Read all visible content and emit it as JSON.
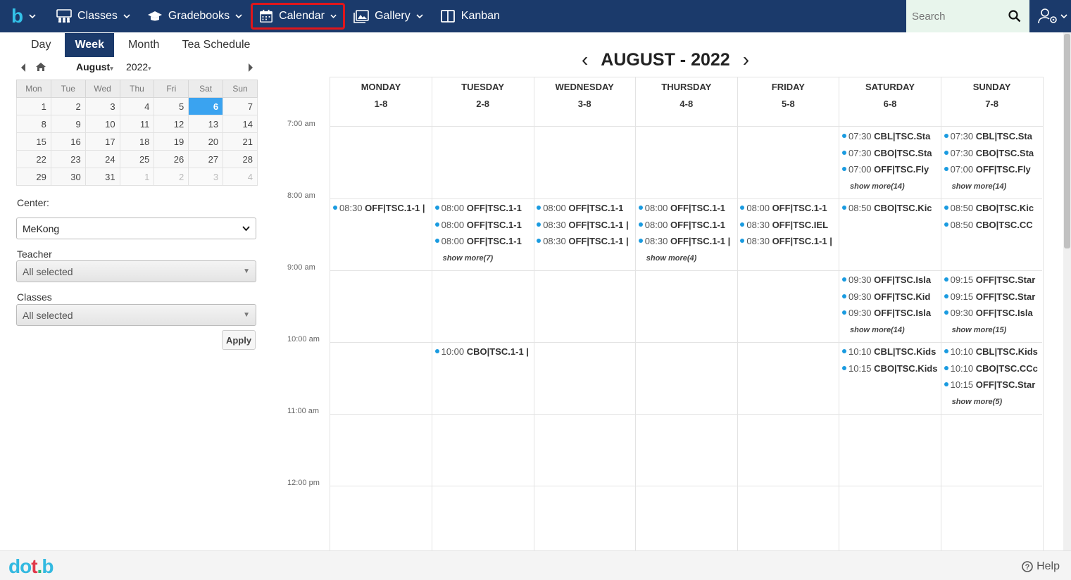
{
  "nav": {
    "brand_letter": "b",
    "items": [
      {
        "label": "Classes",
        "icon": "classes-icon"
      },
      {
        "label": "Gradebooks",
        "icon": "graduation-cap-icon"
      },
      {
        "label": "Calendar",
        "icon": "calendar-icon",
        "highlighted": true
      },
      {
        "label": "Gallery",
        "icon": "gallery-icon"
      },
      {
        "label": "Kanban",
        "icon": "kanban-icon"
      }
    ],
    "search_placeholder": "Search"
  },
  "view_tabs": [
    "Day",
    "Week",
    "Month",
    "Tea Schedule"
  ],
  "active_view": "Week",
  "mini_calendar": {
    "month": "August",
    "year": "2022",
    "weekdays": [
      "Mon",
      "Tue",
      "Wed",
      "Thu",
      "Fri",
      "Sat",
      "Sun"
    ],
    "weeks": [
      [
        "1",
        "2",
        "3",
        "4",
        "5",
        "6",
        "7"
      ],
      [
        "8",
        "9",
        "10",
        "11",
        "12",
        "13",
        "14"
      ],
      [
        "15",
        "16",
        "17",
        "18",
        "19",
        "20",
        "21"
      ],
      [
        "22",
        "23",
        "24",
        "25",
        "26",
        "27",
        "28"
      ],
      [
        "29",
        "30",
        "31",
        "1",
        "2",
        "3",
        "4"
      ]
    ],
    "selected": "6"
  },
  "filters": {
    "center_label": "Center:",
    "center_value": "MeKong",
    "teacher_label": "Teacher",
    "teacher_value": "All selected",
    "classes_label": "Classes",
    "classes_value": "All selected",
    "apply_label": "Apply"
  },
  "calendar": {
    "title": "AUGUST - 2022",
    "prev": "‹",
    "next": "›",
    "days": [
      {
        "name": "MONDAY",
        "date": "1-8"
      },
      {
        "name": "TUESDAY",
        "date": "2-8"
      },
      {
        "name": "WEDNESDAY",
        "date": "3-8"
      },
      {
        "name": "THURSDAY",
        "date": "4-8"
      },
      {
        "name": "FRIDAY",
        "date": "5-8"
      },
      {
        "name": "SATURDAY",
        "date": "6-8"
      },
      {
        "name": "SUNDAY",
        "date": "7-8"
      }
    ],
    "times": [
      "7:00 am",
      "8:00 am",
      "9:00 am",
      "10:00 am",
      "11:00 am",
      "12:00 pm"
    ],
    "slots": [
      {
        "day": 5,
        "hour": 0,
        "events": [
          [
            "07:30",
            "CBL|TSC.Sta"
          ],
          [
            "07:30",
            "CBO|TSC.Sta"
          ],
          [
            "07:00",
            "OFF|TSC.Fly"
          ]
        ],
        "more": "show more(14)"
      },
      {
        "day": 6,
        "hour": 0,
        "events": [
          [
            "07:30",
            "CBL|TSC.Sta"
          ],
          [
            "07:30",
            "CBO|TSC.Sta"
          ],
          [
            "07:00",
            "OFF|TSC.Fly"
          ]
        ],
        "more": "show more(14)"
      },
      {
        "day": 0,
        "hour": 1,
        "events": [
          [
            "08:30",
            "OFF|TSC.1-1 |"
          ]
        ],
        "more": ""
      },
      {
        "day": 1,
        "hour": 1,
        "events": [
          [
            "08:00",
            "OFF|TSC.1-1"
          ],
          [
            "08:00",
            "OFF|TSC.1-1"
          ],
          [
            "08:00",
            "OFF|TSC.1-1"
          ]
        ],
        "more": "show more(7)"
      },
      {
        "day": 2,
        "hour": 1,
        "events": [
          [
            "08:00",
            "OFF|TSC.1-1"
          ],
          [
            "08:30",
            "OFF|TSC.1-1 |"
          ],
          [
            "08:30",
            "OFF|TSC.1-1 |"
          ]
        ],
        "more": ""
      },
      {
        "day": 3,
        "hour": 1,
        "events": [
          [
            "08:00",
            "OFF|TSC.1-1"
          ],
          [
            "08:00",
            "OFF|TSC.1-1"
          ],
          [
            "08:30",
            "OFF|TSC.1-1 |"
          ]
        ],
        "more": "show more(4)"
      },
      {
        "day": 4,
        "hour": 1,
        "events": [
          [
            "08:00",
            "OFF|TSC.1-1"
          ],
          [
            "08:30",
            "OFF|TSC.IEL"
          ],
          [
            "08:30",
            "OFF|TSC.1-1 |"
          ]
        ],
        "more": ""
      },
      {
        "day": 5,
        "hour": 1,
        "events": [
          [
            "08:50",
            "CBO|TSC.Kic"
          ]
        ],
        "more": ""
      },
      {
        "day": 6,
        "hour": 1,
        "events": [
          [
            "08:50",
            "CBO|TSC.Kic"
          ],
          [
            "08:50",
            "CBO|TSC.CC"
          ]
        ],
        "more": ""
      },
      {
        "day": 5,
        "hour": 2,
        "events": [
          [
            "09:30",
            "OFF|TSC.Isla"
          ],
          [
            "09:30",
            "OFF|TSC.Kid"
          ],
          [
            "09:30",
            "OFF|TSC.Isla"
          ]
        ],
        "more": "show more(14)"
      },
      {
        "day": 6,
        "hour": 2,
        "events": [
          [
            "09:15",
            "OFF|TSC.Star"
          ],
          [
            "09:15",
            "OFF|TSC.Star"
          ],
          [
            "09:30",
            "OFF|TSC.Isla"
          ]
        ],
        "more": "show more(15)"
      },
      {
        "day": 1,
        "hour": 3,
        "events": [
          [
            "10:00",
            "CBO|TSC.1-1 |"
          ]
        ],
        "more": ""
      },
      {
        "day": 5,
        "hour": 3,
        "events": [
          [
            "10:10",
            "CBL|TSC.Kids"
          ],
          [
            "10:15",
            "CBO|TSC.Kids"
          ]
        ],
        "more": ""
      },
      {
        "day": 6,
        "hour": 3,
        "events": [
          [
            "10:10",
            "CBL|TSC.Kids"
          ],
          [
            "10:10",
            "CBO|TSC.CCc"
          ],
          [
            "10:15",
            "OFF|TSC.Star"
          ]
        ],
        "more": "show more(5)"
      }
    ]
  },
  "footer": {
    "logo_parts": [
      "do",
      "t",
      ".",
      "b"
    ],
    "help_label": "Help"
  },
  "colors": {
    "nav_bg": "#1b3a6b",
    "accent": "#33c1e8",
    "today": "#3aa3f0",
    "highlight": "#e0161b",
    "event_dot": "#1a9be0"
  }
}
